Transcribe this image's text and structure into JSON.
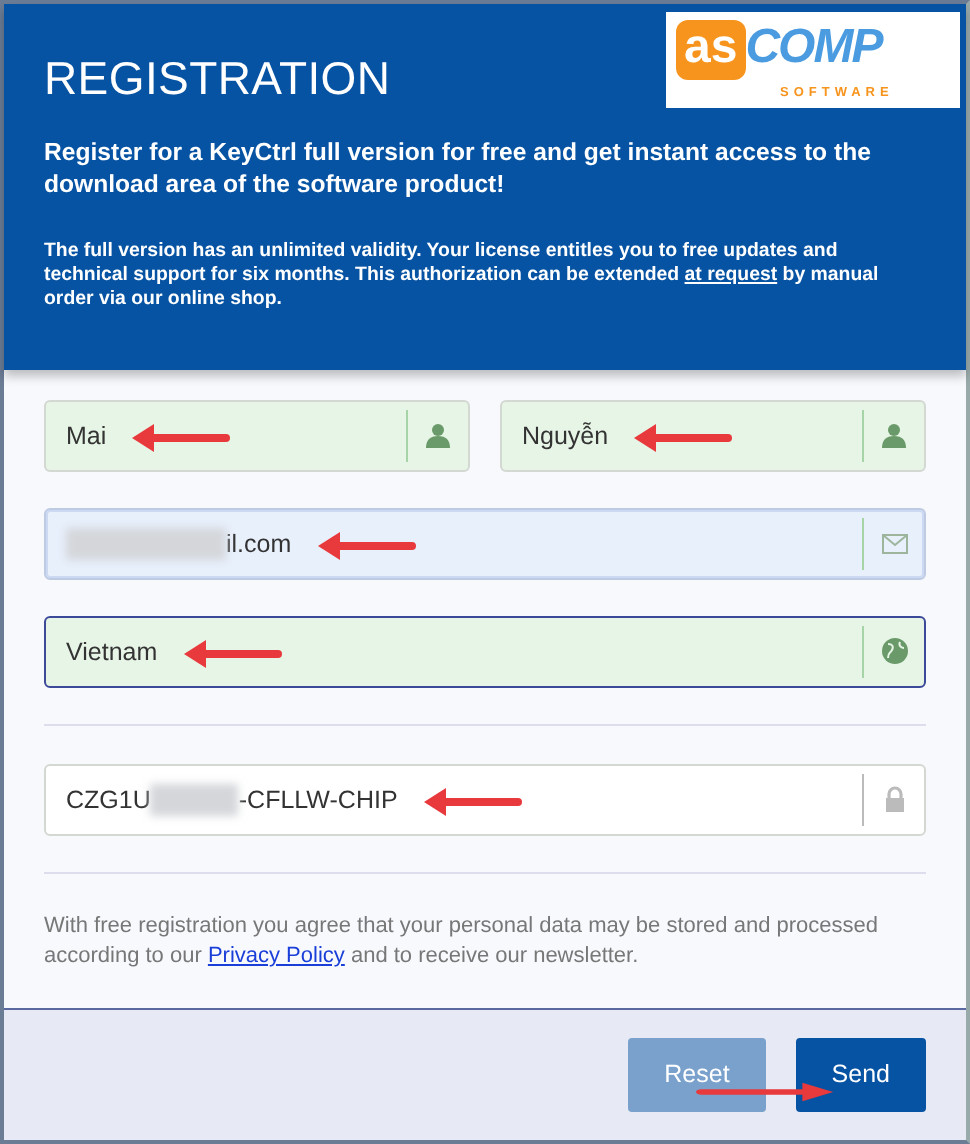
{
  "header": {
    "title": "REGISTRATION",
    "logo": {
      "mark": "as",
      "name": "COMP",
      "tagline": "SOFTWARE"
    },
    "lead": "Register for a KeyCtrl full version for free and get instant access to the download area of the software product!",
    "note": {
      "before": "The full version has an unlimited validity. Your license entitles you to free updates and technical support for six months. This authorization can be extended ",
      "link": "at request",
      "after": " by manual order via our online shop."
    }
  },
  "field_rows": [
    {
      "fields": [
        {
          "kind": "name",
          "value": "Mai",
          "valid": true,
          "autofilled": false,
          "focused": false,
          "annotated": true
        },
        {
          "kind": "name",
          "value": "Nguyễn",
          "valid": true,
          "autofilled": false,
          "focused": false,
          "annotated": true
        }
      ]
    },
    {
      "fields": [
        {
          "kind": "email",
          "redacted": true,
          "after": "il.com",
          "valid": false,
          "autofilled": true,
          "focused": false,
          "annotated": true
        }
      ]
    },
    {
      "fields": [
        {
          "kind": "country",
          "value": "Vietnam",
          "valid": true,
          "autofilled": false,
          "focused": true,
          "annotated": true
        }
      ]
    },
    {
      "divider": true,
      "fields": [
        {
          "kind": "license",
          "redacted": true,
          "before": "CZG1U",
          "after": "-CFLLW-CHIP",
          "valid": false,
          "autofilled": false,
          "focused": false,
          "annotated": true
        }
      ]
    }
  ],
  "consent": {
    "before": "With free registration you agree that your personal data may be stored and processed according to our ",
    "link": "Privacy Policy",
    "after": " and to receive our newsletter."
  },
  "buttons": [
    {
      "label": "Reset",
      "disabled": true,
      "annotated": false
    },
    {
      "label": "Send",
      "disabled": false,
      "annotated": true
    }
  ]
}
